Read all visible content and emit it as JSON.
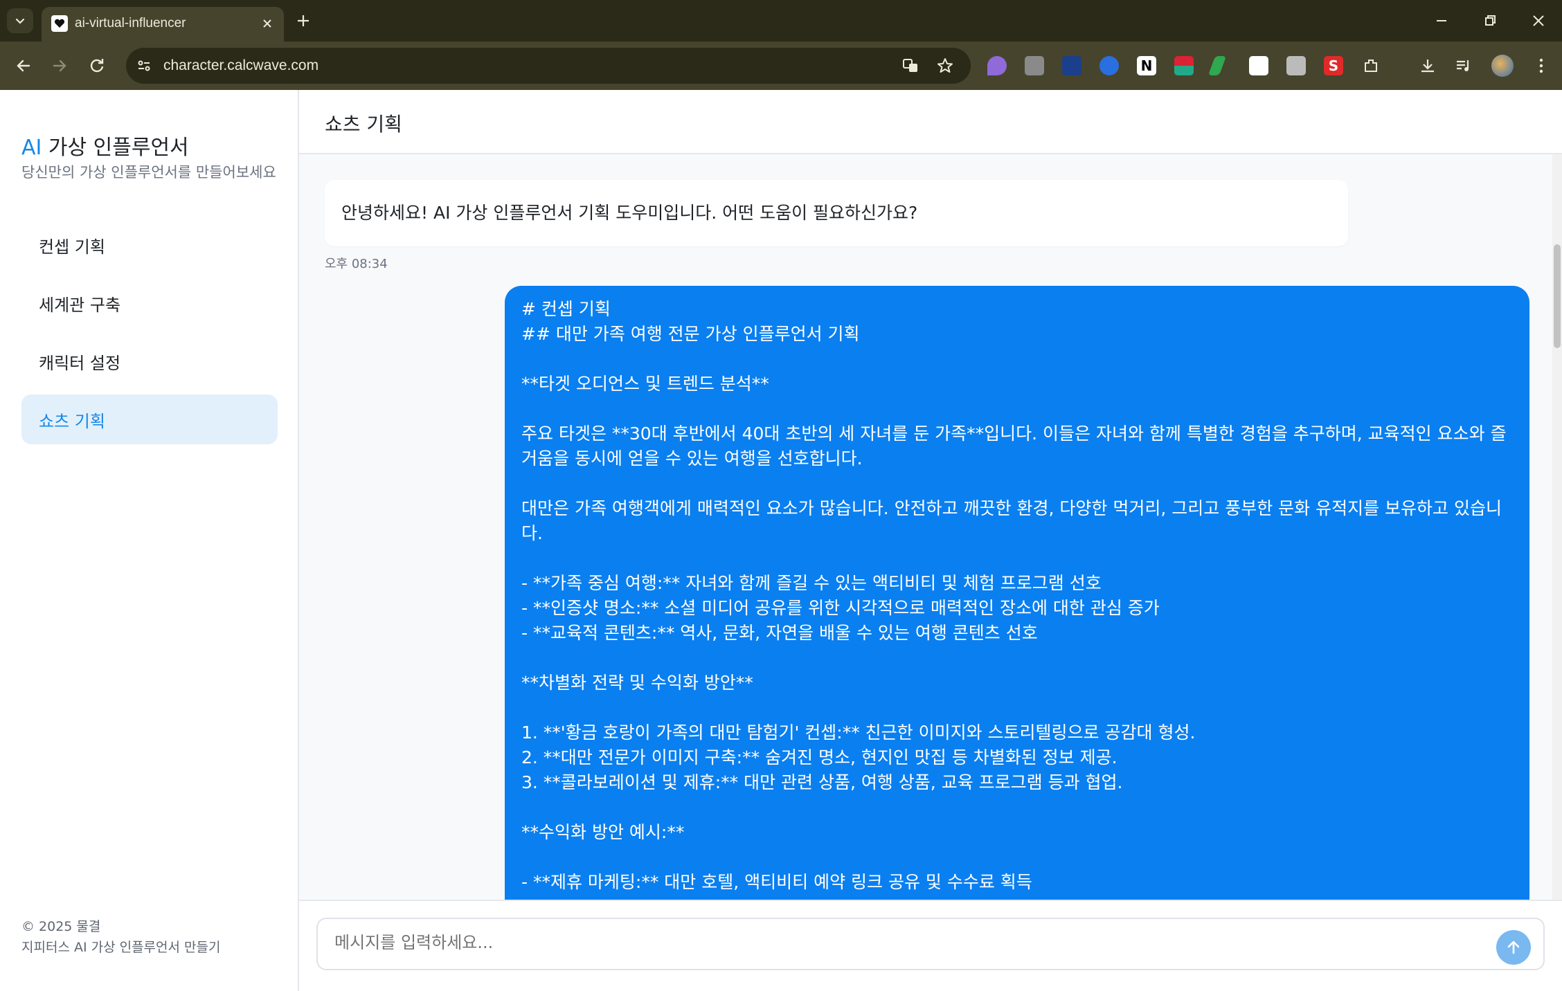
{
  "browser": {
    "tab_title": "ai-virtual-influencer",
    "url": "character.calcwave.com"
  },
  "sidebar": {
    "brand_ai": "AI",
    "brand_rest": " 가상 인플루언서",
    "subtitle": "당신만의 가상 인플루언서를 만들어보세요",
    "items": [
      {
        "label": "컨셉 기획"
      },
      {
        "label": "세계관 구축"
      },
      {
        "label": "캐릭터 설정"
      },
      {
        "label": "쇼츠 기획"
      }
    ],
    "footer_line1": "© 2025 물결",
    "footer_line2": "지피터스 AI 가상 인플루언서 만들기"
  },
  "main": {
    "title": "쇼츠 기획",
    "bot_message": "안녕하세요! AI 가상 인플루언서 기획 도우미입니다. 어떤 도움이 필요하신가요?",
    "bot_time": "오후 08:34",
    "user_lines": [
      "# 컨셉 기획",
      "## 대만 가족 여행 전문 가상 인플루언서 기획",
      "",
      "**타겟 오디언스 및 트렌드 분석**",
      "",
      "주요 타겟은 **30대 후반에서 40대 초반의 세 자녀를 둔 가족**입니다. 이들은 자녀와 함께 특별한 경험을 추구하며, 교육적인 요소와 즐거움을 동시에 얻을 수 있는 여행을 선호합니다.",
      "",
      "대만은 가족 여행객에게 매력적인 요소가 많습니다. 안전하고 깨끗한 환경, 다양한 먹거리, 그리고 풍부한 문화 유적지를 보유하고 있습니다.",
      "",
      "- **가족 중심 여행:** 자녀와 함께 즐길 수 있는 액티비티 및 체험 프로그램 선호",
      "- **인증샷 명소:** 소셜 미디어 공유를 위한 시각적으로 매력적인 장소에 대한 관심 증가",
      "- **교육적 콘텐츠:** 역사, 문화, 자연을 배울 수 있는 여행 콘텐츠 선호",
      "",
      "**차별화 전략 및 수익화 방안**",
      "",
      "1. **'황금 호랑이 가족의 대만 탐험기' 컨셉:** 친근한 이미지와 스토리텔링으로 공감대 형성.",
      "2. **대만 전문가 이미지 구축:** 숨겨진 명소, 현지인 맛집 등 차별화된 정보 제공.",
      "3. **콜라보레이션 및 제휴:** 대만 관련 상품, 여행 상품, 교육 프로그램 등과 협업.",
      "",
      "**수익화 방안 예시:**",
      "",
      "- **제휴 마케팅:** 대만 호텔, 액티비티 예약 링크 공유 및 수수료 획득"
    ],
    "input_placeholder": "메시지를 입력하세요..."
  },
  "colors": {
    "accent": "#1687e6",
    "user_bubble": "#0a7ff0",
    "active_nav_bg": "#e2f0fc"
  },
  "icons": [
    "chevron-down-icon",
    "heart-icon",
    "close-icon",
    "plus-icon",
    "minimize-icon",
    "restore-icon",
    "back-icon",
    "forward-icon",
    "reload-icon",
    "site-info-icon",
    "translate-icon",
    "star-icon",
    "extensions-icon",
    "download-icon",
    "media-icon",
    "profile-icon",
    "menu-icon",
    "send-arrow-icon"
  ]
}
